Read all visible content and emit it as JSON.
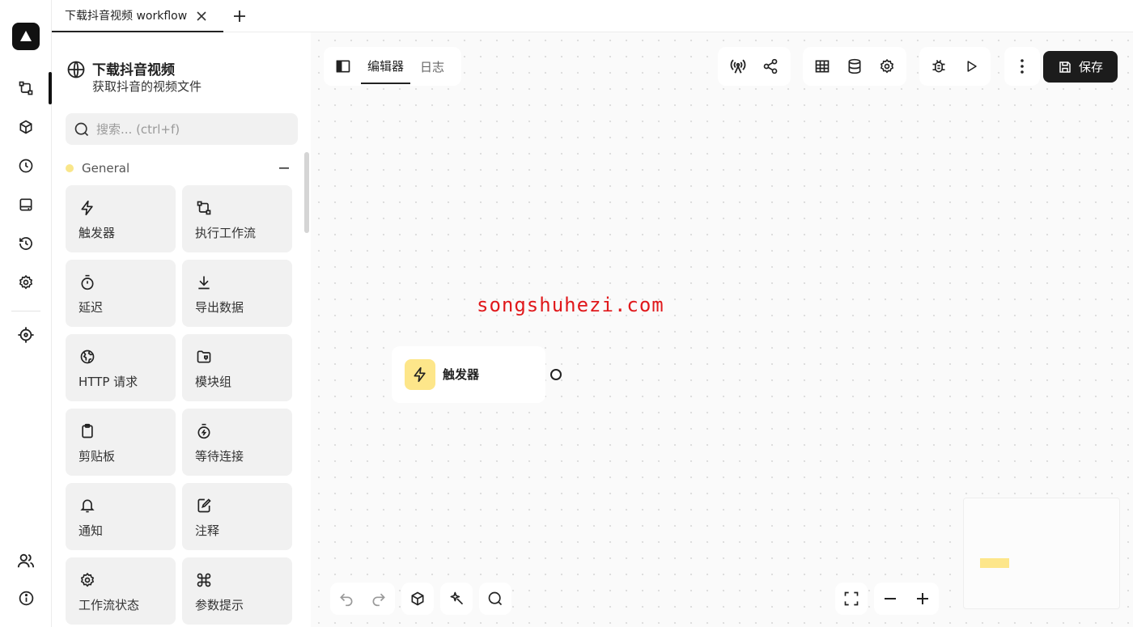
{
  "tab": {
    "title": "下载抖音视频 workflow"
  },
  "workflow": {
    "name": "下载抖音视频",
    "description": "获取抖音的视频文件"
  },
  "search": {
    "placeholder": "搜索... (ctrl+f)"
  },
  "category": {
    "name": "General",
    "color": "#f9e68a"
  },
  "blocks": [
    {
      "label": "触发器",
      "icon": "lightning-icon"
    },
    {
      "label": "执行工作流",
      "icon": "workflow-icon"
    },
    {
      "label": "延迟",
      "icon": "timer-icon"
    },
    {
      "label": "导出数据",
      "icon": "download-icon"
    },
    {
      "label": "HTTP 请求",
      "icon": "globe-icon"
    },
    {
      "label": "模块组",
      "icon": "folder-icon"
    },
    {
      "label": "剪贴板",
      "icon": "clipboard-icon"
    },
    {
      "label": "等待连接",
      "icon": "stopwatch-bolt-icon"
    },
    {
      "label": "通知",
      "icon": "bell-icon"
    },
    {
      "label": "注释",
      "icon": "note-icon"
    },
    {
      "label": "工作流状态",
      "icon": "gear-icon"
    },
    {
      "label": "参数提示",
      "icon": "command-icon"
    }
  ],
  "editor": {
    "tab_editor": "编辑器",
    "tab_logs": "日志",
    "save_label": "保存"
  },
  "node": {
    "label": "触发器",
    "color": "#fde68a"
  },
  "watermark": "songshuhezi.com"
}
